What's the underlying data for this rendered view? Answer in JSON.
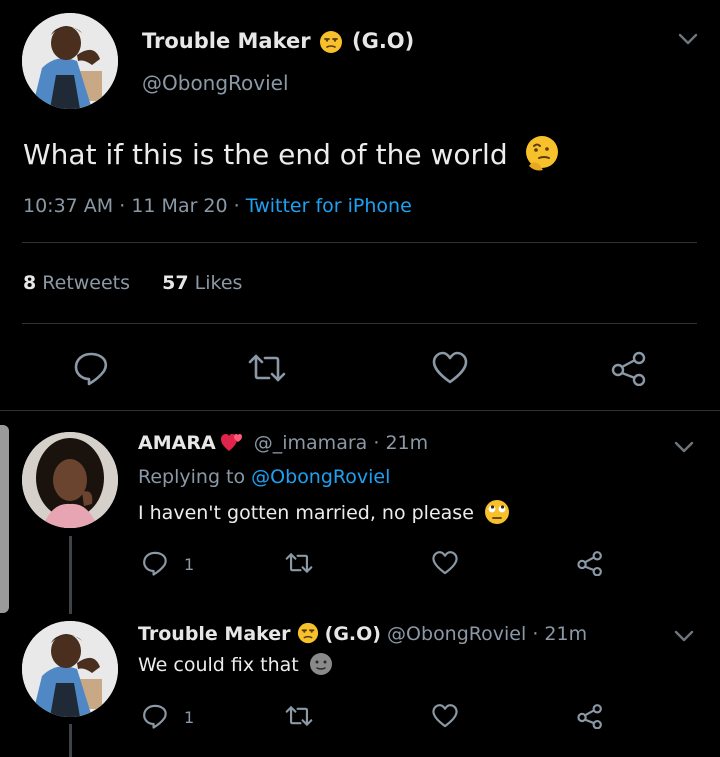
{
  "main_tweet": {
    "display_name": "Trouble Maker",
    "name_suffix": "(G.O)",
    "handle": "@ObongRoviel",
    "text": "What if this is the end of the world",
    "time": "10:37 AM",
    "date": "11 Mar 20",
    "client": "Twitter for iPhone",
    "retweet_count": "8",
    "retweet_label": "Retweets",
    "like_count": "57",
    "like_label": "Likes"
  },
  "replies": [
    {
      "display_name": "AMARA",
      "handle": "@_imamara",
      "age": "21m",
      "replying_prefix": "Replying to",
      "replying_handle": "@ObongRoviel",
      "text": "I haven't gotten married, no please",
      "reply_count": "1"
    },
    {
      "display_name": "Trouble Maker",
      "name_suffix": "(G.O)",
      "handle": "@ObongRoviel",
      "age": "21m",
      "text": "We could fix that",
      "reply_count": "1"
    }
  ],
  "colors": {
    "background": "#000000",
    "accent": "#1da1f2",
    "muted": "#8b98a5",
    "divider": "#2f3336"
  }
}
